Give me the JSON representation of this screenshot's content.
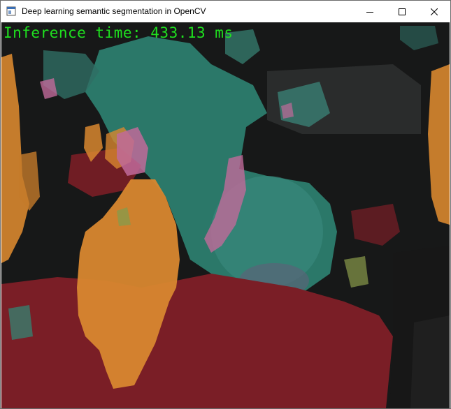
{
  "window": {
    "title": "Deep learning semantic segmentation in OpenCV"
  },
  "titlebar_buttons": {
    "minimize_icon": "minimize-icon",
    "maximize_icon": "maximize-icon",
    "close_icon": "close-icon"
  },
  "overlay": {
    "inference_text": "Inference time: 433.13 ms",
    "text_color": "#1fe01f"
  },
  "segmentation_colors": {
    "road": "#7a1e26",
    "person": "#d8872f",
    "bicycle": "#2f8a78",
    "background_vehicle": "#2a3a38",
    "pink": "#c06a9a",
    "olive": "#8a9a4a",
    "dark": "#171818"
  }
}
